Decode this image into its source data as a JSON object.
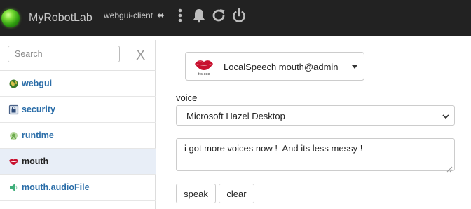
{
  "navbar": {
    "brand": "MyRobotLab",
    "client_label": "webgui-client",
    "client_arrows": "⬌",
    "icons": [
      "status-orb",
      "kebab-menu-icon",
      "bell-icon",
      "refresh-icon",
      "power-icon"
    ]
  },
  "sidebar": {
    "search_placeholder": "Search",
    "close_label": "X",
    "items": [
      {
        "label": "webgui",
        "icon": "globe-icon"
      },
      {
        "label": "security",
        "icon": "lock-icon"
      },
      {
        "label": "runtime",
        "icon": "runtime-icon"
      },
      {
        "label": "mouth",
        "icon": "lips-icon",
        "active": true
      },
      {
        "label": "mouth.audioFile",
        "icon": "speaker-icon"
      }
    ]
  },
  "main": {
    "service_select": {
      "icon": "lips-icon",
      "value": "LocalSpeech  mouth@admin"
    },
    "voice": {
      "label": "voice",
      "value": "Microsoft Hazel Desktop"
    },
    "speech_text": "i got more voices now !  And its less messy !",
    "buttons": {
      "speak": "speak",
      "clear": "clear"
    }
  },
  "colors": {
    "navbar_bg": "#222222",
    "nav_text": "#c9c9c9",
    "link_blue": "#2a6da8",
    "active_row": "#e8eef7",
    "status_green": "#3fbf17"
  }
}
